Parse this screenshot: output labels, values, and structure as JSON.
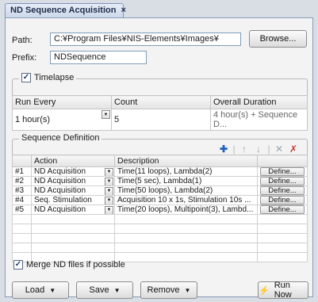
{
  "tab": {
    "title": "ND Sequence Acquisition",
    "close": "×"
  },
  "path": {
    "label": "Path:",
    "value": "C:¥Program Files¥NIS-Elements¥Images¥",
    "browse_label": "Browse..."
  },
  "prefix": {
    "label": "Prefix:",
    "value": "NDSequence"
  },
  "timelapse": {
    "label": "Timelapse",
    "checked_glyph": "✓",
    "headers": [
      "Run Every",
      "Count",
      "Overall Duration"
    ],
    "run_every": "1 hour(s)",
    "count": "5",
    "duration": "4 hour(s) + Sequence D..."
  },
  "sequence": {
    "label": "Sequence Definition",
    "headers": [
      "",
      "Action",
      "Description",
      ""
    ],
    "rows": [
      {
        "num": "#1",
        "action": "ND Acquisition",
        "desc": "Time(11 loops), Lambda(2)",
        "define": "Define..."
      },
      {
        "num": "#2",
        "action": "ND Acquisition",
        "desc": "Time(5 sec), Lambda(1)",
        "define": "Define..."
      },
      {
        "num": "#3",
        "action": "ND Acquisition",
        "desc": "Time(50 loops), Lambda(2)",
        "define": "Define..."
      },
      {
        "num": "#4",
        "action": "Seq. Stimulation",
        "desc": "Acquisition 10 x 1s, Stimulation 10s ...",
        "define": "Define..."
      },
      {
        "num": "#5",
        "action": "ND Acquisition",
        "desc": "Time(20 loops), Multipoint(3), Lambd...",
        "define": "Define..."
      }
    ],
    "empty_rows": 5,
    "icons": {
      "add": "add-icon",
      "up": "move-up-icon",
      "down": "move-down-icon",
      "remove": "remove-icon",
      "clear": "clear-icon"
    }
  },
  "merge": {
    "label": "Merge ND files if possible",
    "checked_glyph": "✓"
  },
  "footer": {
    "load": "Load",
    "save": "Save",
    "remove": "Remove",
    "run": "Run Now"
  },
  "colors": {
    "accent": "#1f5fbf",
    "panel": "#f3f3f3",
    "border": "#8a9bb8"
  }
}
